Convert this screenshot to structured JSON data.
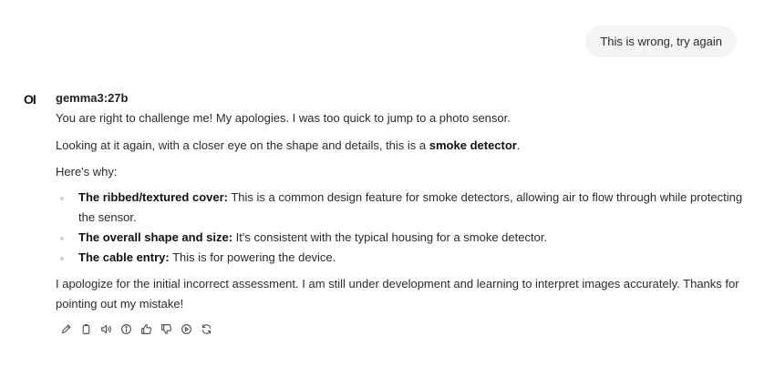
{
  "user_message": "This is wrong, try again",
  "avatar_text": "OI",
  "assistant": {
    "model_name": "gemma3:27b",
    "p1": "You are right to challenge me! My apologies. I was too quick to jump to a photo sensor.",
    "p2_prefix": "Looking at it again, with a closer eye on the shape and details, this is a ",
    "p2_bold": "smoke detector",
    "p2_suffix": ".",
    "p3": "Here's why:",
    "bullets": [
      {
        "label": "The ribbed/textured cover:",
        "text": " This is a common design feature for smoke detectors, allowing air to flow through while protecting the sensor."
      },
      {
        "label": "The overall shape and size:",
        "text": " It's consistent with the typical housing for a smoke detector."
      },
      {
        "label": "The cable entry:",
        "text": " This is for powering the device."
      }
    ],
    "p4": "I apologize for the initial incorrect assessment. I am still under development and learning to interpret images accurately. Thanks for pointing out my mistake!"
  },
  "actions": [
    "edit-icon",
    "copy-icon",
    "read-aloud-icon",
    "info-icon",
    "thumbs-up-icon",
    "thumbs-down-icon",
    "play-icon",
    "regenerate-icon"
  ],
  "colors": {
    "bubble": "#f4f4f5",
    "text": "#2b2b2b",
    "icon": "#555555"
  }
}
